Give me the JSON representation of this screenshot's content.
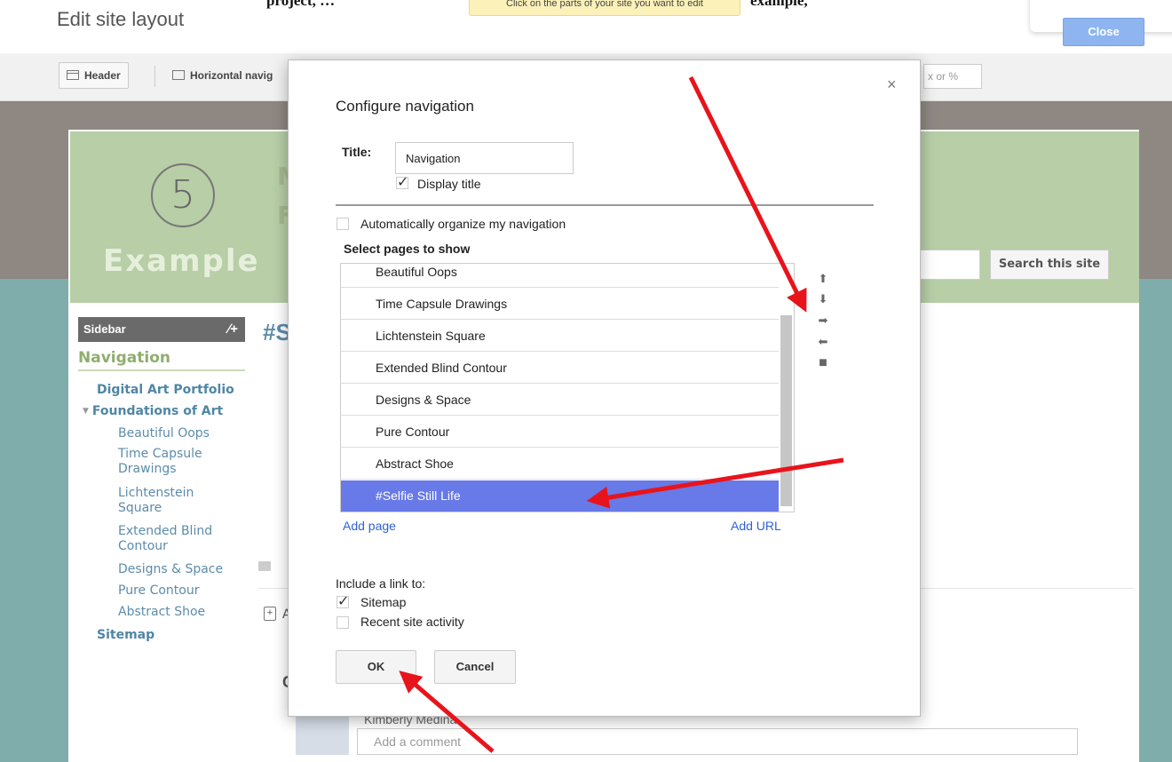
{
  "topbar": {
    "page_title": "Edit site layout",
    "cut_text_left": "project, …",
    "cut_text_right": "example,",
    "tip": "Click on the parts of your site you want to edit",
    "close_label": "Close"
  },
  "toolbar": {
    "header_label": "Header",
    "horizontal_nav_label": "Horizontal navig",
    "width_placeholder": "x or %"
  },
  "site": {
    "logo_number": "5",
    "header_letter_1": "M",
    "header_letter_2": "F",
    "header_text": "Example",
    "search_button": "Search this site",
    "main_heading": "#S",
    "add_icon": "+",
    "add_label_fragment": "A",
    "comment_letter": "C",
    "commenter_name": "Kimberly Medina",
    "comment_placeholder": "Add a comment"
  },
  "sidebar": {
    "bar_label": "Sidebar",
    "tools": "∕+",
    "title": "Navigation",
    "links": [
      "Digital Art Portfolio",
      "Foundations of Art",
      "Beautiful Oops",
      "Time Capsule",
      "Drawings",
      "Lichtenstein",
      "Square",
      "Extended Blind",
      "Contour",
      "Designs & Space",
      "Pure Contour",
      "Abstract Shoe",
      "Sitemap"
    ]
  },
  "dialog": {
    "close_glyph": "×",
    "title": "Configure navigation",
    "title_label": "Title:",
    "title_value": "Navigation",
    "display_title_label": "Display title",
    "auto_organize_label": "Automatically organize my navigation",
    "select_pages_label": "Select pages to show",
    "pages": [
      "Beautiful Oops",
      "Time Capsule Drawings",
      "Lichtenstein Square",
      "Extended Blind Contour",
      "Designs & Space",
      "Pure Contour",
      "Abstract Shoe",
      "#Selfie Still Life"
    ],
    "selected_page": "#Selfie Still Life",
    "controls": {
      "up": "⬆",
      "down": "⬇",
      "right": "➡",
      "left": "⬅",
      "trash": "■"
    },
    "add_page": "Add page",
    "add_url": "Add URL",
    "include_label": "Include a link to:",
    "sitemap_label": "Sitemap",
    "recent_activity_label": "Recent site activity",
    "ok_label": "OK",
    "cancel_label": "Cancel"
  },
  "colors": {
    "selected_row": "#6879e8",
    "link": "#2f61d5",
    "annotation_arrow": "#e8141b",
    "header_green": "#b7cea7",
    "teal_background": "#7fadab"
  }
}
